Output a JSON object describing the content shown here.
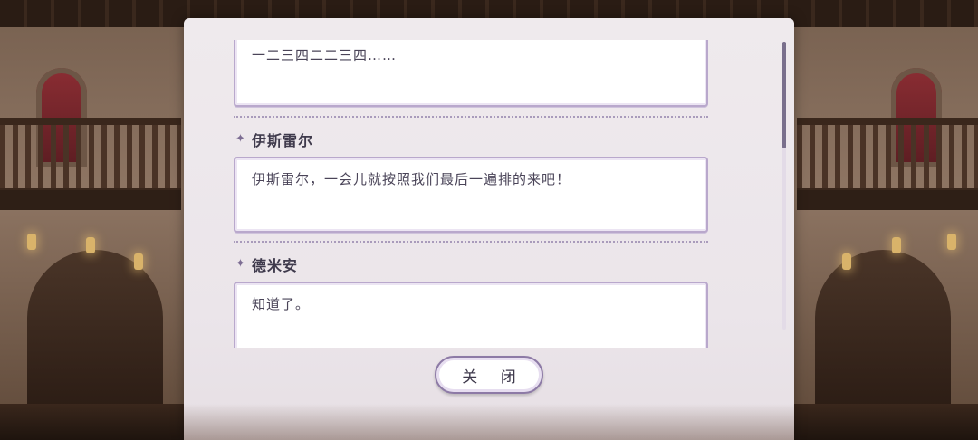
{
  "dialog_log": {
    "entries": [
      {
        "speaker": "",
        "text": "一二三四二二三四……"
      },
      {
        "speaker": "伊斯雷尔",
        "text": "伊斯雷尔，一会儿就按照我们最后一遍排的来吧！"
      },
      {
        "speaker": "德米安",
        "text": "知道了。"
      }
    ],
    "close_label": "关 闭",
    "speaker_marker_icon": "sparkle-icon",
    "scroll_fraction_visible": 0.37
  },
  "colors": {
    "panel_bg": "#efeaed",
    "box_border": "#b9a8cc",
    "divider": "#a99bbb",
    "text": "#4a4458",
    "accent": "#7d6d93"
  }
}
